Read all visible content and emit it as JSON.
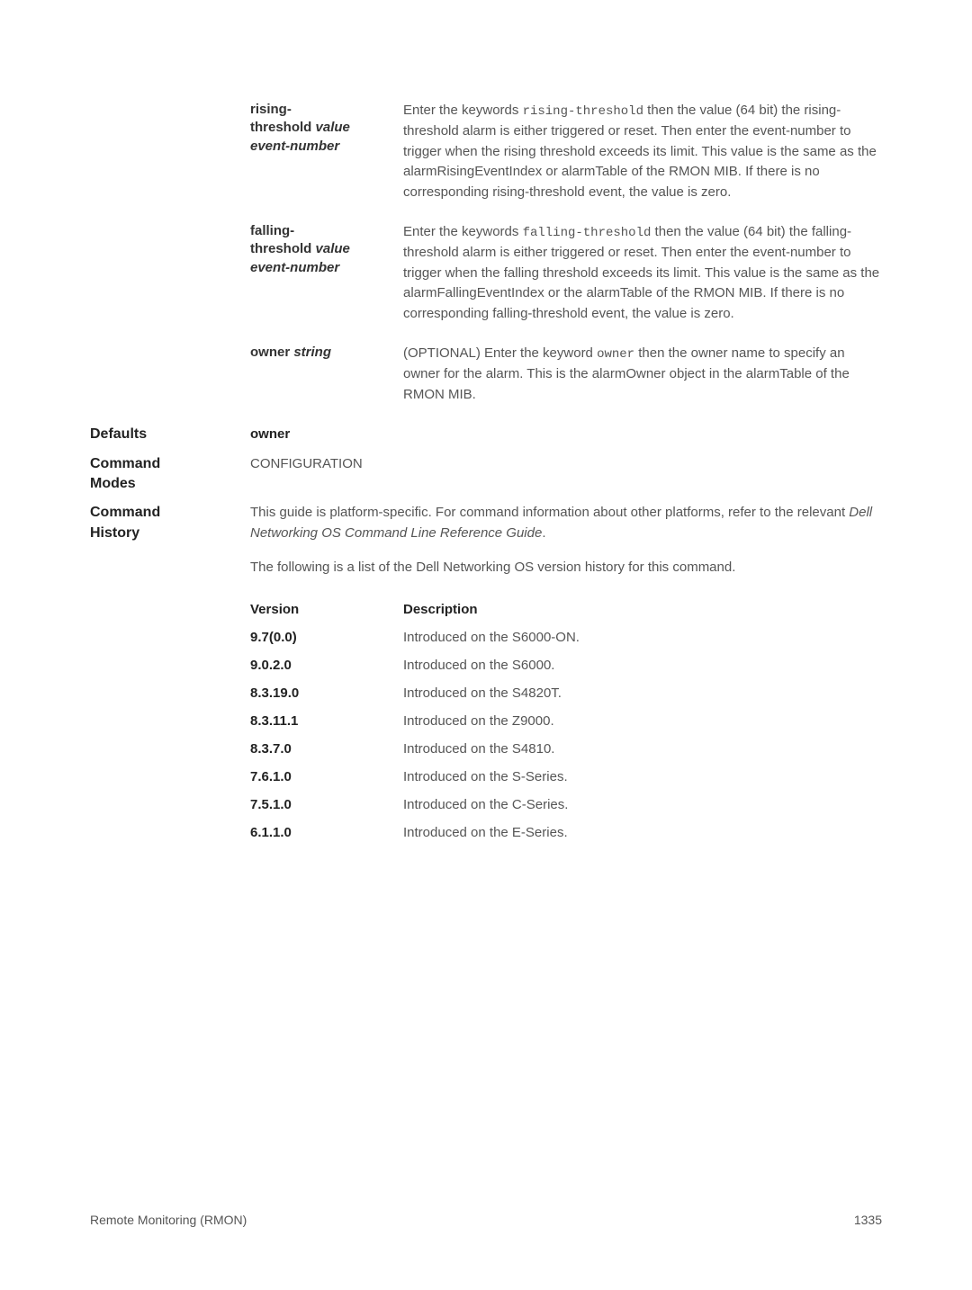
{
  "params": [
    {
      "label_line1": "rising-",
      "label_line2": "threshold ",
      "label_ital2": "value",
      "label_line3": "",
      "label_ital3": "event-number",
      "desc_pre": "Enter the keywords ",
      "desc_mono": "rising-threshold",
      "desc_post": " then the value (64 bit) the rising-threshold alarm is either triggered or reset. Then enter the event-number to trigger when the rising threshold exceeds its limit. This value is the same as the alarmRisingEventIndex or alarmTable of the RMON MIB. If there is no corresponding rising-threshold event, the value is zero."
    },
    {
      "label_line1": "falling-",
      "label_line2": "threshold ",
      "label_ital2": "value",
      "label_line3": "",
      "label_ital3": "event-number",
      "desc_pre": "Enter the keywords ",
      "desc_mono": "falling-threshold",
      "desc_post": " then the value (64 bit) the falling-threshold alarm is either triggered or reset. Then enter the event-number to trigger when the falling threshold exceeds its limit. This value is the same as the alarmFallingEventIndex or the alarmTable of the RMON MIB. If there is no corresponding falling-threshold event, the value is zero."
    },
    {
      "label_line1": "owner ",
      "label_ital1": "string",
      "desc_pre": "(OPTIONAL) Enter the keyword ",
      "desc_mono": "owner",
      "desc_post": " then the owner name to specify an owner for the alarm. This is the alarmOwner object in the alarmTable of the RMON MIB."
    }
  ],
  "defaults": {
    "label": "Defaults",
    "value": "owner"
  },
  "command_modes": {
    "label": "Command Modes",
    "value": "CONFIGURATION"
  },
  "command_history": {
    "label": "Command History",
    "para1_pre": "This guide is platform-specific. For command information about other platforms, refer to the relevant ",
    "para1_ital": "Dell Networking OS Command Line Reference Guide",
    "para1_post": ".",
    "para2": "The following is a list of the Dell Networking OS version history for this command."
  },
  "version_table": {
    "header": {
      "c1": "Version",
      "c2": "Description"
    },
    "rows": [
      {
        "c1": "9.7(0.0)",
        "c2": "Introduced on the S6000-ON."
      },
      {
        "c1": "9.0.2.0",
        "c2": "Introduced on the S6000."
      },
      {
        "c1": "8.3.19.0",
        "c2": "Introduced on the S4820T."
      },
      {
        "c1": "8.3.11.1",
        "c2": "Introduced on the Z9000."
      },
      {
        "c1": "8.3.7.0",
        "c2": "Introduced on the S4810."
      },
      {
        "c1": "7.6.1.0",
        "c2": "Introduced on the S-Series."
      },
      {
        "c1": "7.5.1.0",
        "c2": "Introduced on the C-Series."
      },
      {
        "c1": "6.1.1.0",
        "c2": "Introduced on the E-Series."
      }
    ]
  },
  "footer": {
    "left": "Remote Monitoring (RMON)",
    "right": "1335"
  }
}
